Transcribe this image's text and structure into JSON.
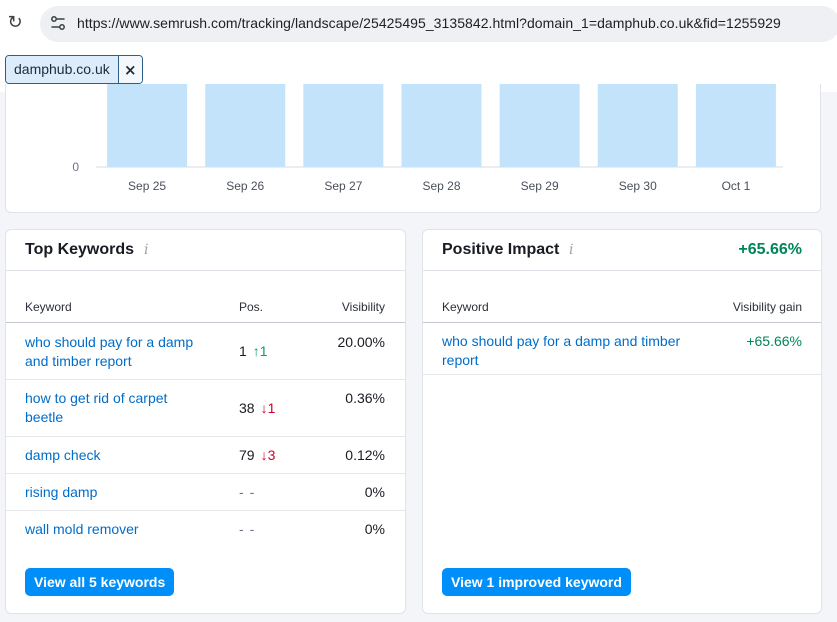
{
  "browser": {
    "url": "https://www.semrush.com/tracking/landscape/25425495_3135842.html?domain_1=damphub.co.uk&fid=1255929"
  },
  "filter": {
    "domain_chip": "damphub.co.uk",
    "close_glyph": "×"
  },
  "chart_data": {
    "type": "bar",
    "categories": [
      "Sep 25",
      "Sep 26",
      "Sep 27",
      "Sep 28",
      "Sep 29",
      "Sep 30",
      "Oct 1"
    ],
    "y_tick_labels": [
      "0"
    ],
    "bar_color": "#c3e3fb",
    "grid": true,
    "note_visible": "Bars extend above the visible crop; only baseline tick 0 is shown"
  },
  "top_keywords": {
    "title": "Top Keywords",
    "info_icon": "i",
    "columns": {
      "keyword": "Keyword",
      "pos": "Pos.",
      "visibility": "Visibility"
    },
    "rows": [
      {
        "keyword_line1": "who should pay for a damp",
        "keyword_line2": "and timber report",
        "pos": "1",
        "change": "↑1",
        "dir": "up",
        "visibility": "20.00%"
      },
      {
        "keyword_line1": "how to get rid of carpet",
        "keyword_line2": "beetle",
        "pos": "38",
        "change": "↓1",
        "dir": "down",
        "visibility": "0.36%"
      },
      {
        "keyword_line1": "damp check",
        "keyword_line2": "",
        "pos": "79",
        "change": "↓3",
        "dir": "down",
        "visibility": "0.12%"
      },
      {
        "keyword_line1": "rising damp",
        "keyword_line2": "",
        "pos": "-",
        "change": "-",
        "dir": "none",
        "visibility": "0%"
      },
      {
        "keyword_line1": "wall mold remover",
        "keyword_line2": "",
        "pos": "-",
        "change": "-",
        "dir": "none",
        "visibility": "0%"
      }
    ],
    "button": "View all 5 keywords"
  },
  "positive_impact": {
    "title": "Positive Impact",
    "info_icon": "i",
    "total": "+65.66%",
    "columns": {
      "keyword": "Keyword",
      "gain": "Visibility gain"
    },
    "rows": [
      {
        "keyword_line1": "who should pay for a damp and timber",
        "keyword_line2": "report",
        "gain": "+65.66%"
      }
    ],
    "button": "View 1 improved keyword"
  },
  "colors": {
    "accent": "#008ff8",
    "link": "#006dca",
    "positive": "#00855a",
    "up": "#009f6b",
    "down": "#d1002f"
  }
}
